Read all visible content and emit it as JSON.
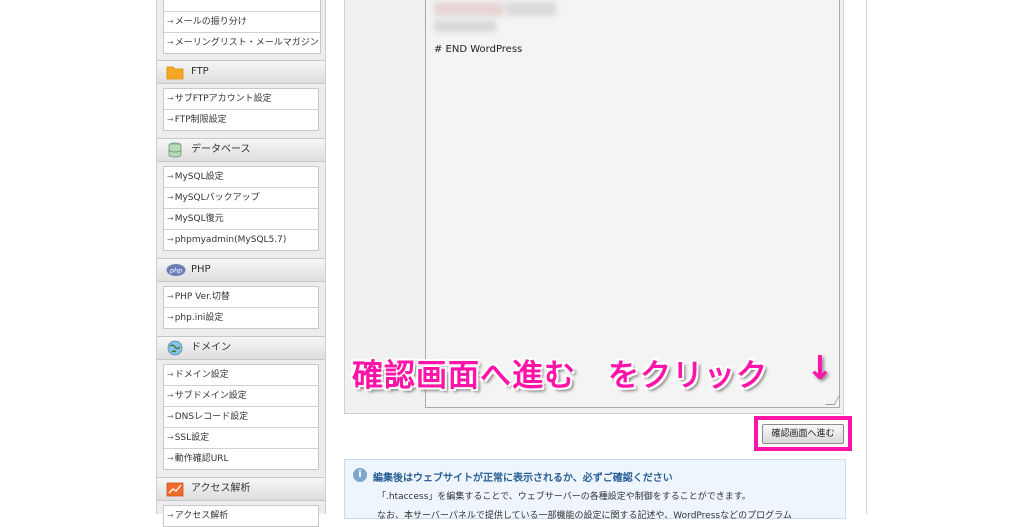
{
  "sidebar": {
    "top_items": [
      "メールの振り分け",
      "メーリングリスト・メールマガジン"
    ],
    "sections": [
      {
        "title": "FTP",
        "icon": "folder-icon",
        "items": [
          "サブFTPアカウント設定",
          "FTP制限設定"
        ]
      },
      {
        "title": "データベース",
        "icon": "database-icon",
        "items": [
          "MySQL設定",
          "MySQLバックアップ",
          "MySQL復元",
          "phpmyadmin(MySQL5.7)"
        ]
      },
      {
        "title": "PHP",
        "icon": "php-icon",
        "items": [
          "PHP Ver.切替",
          "php.ini設定"
        ]
      },
      {
        "title": "ドメイン",
        "icon": "globe-icon",
        "items": [
          "ドメイン設定",
          "サブドメイン設定",
          "DNSレコード設定",
          "SSL設定",
          "動作確認URL"
        ]
      },
      {
        "title": "アクセス解析",
        "icon": "chart-icon",
        "items": [
          "アクセス解析"
        ]
      }
    ]
  },
  "editor": {
    "visible_line": "# END WordPress"
  },
  "annotation": {
    "text": "確認画面へ進む　をクリック",
    "arrow": "↓"
  },
  "confirm_button": {
    "label": "確認画面へ進む"
  },
  "info": {
    "title": "編集後はウェブサイトが正常に表示されるか、必ずご確認ください",
    "text1": "「.htaccess」を編集することで、ウェブサーバーの各種設定や制御をすることができます。",
    "text2": "なお、本サーバーパネルで提供している一部機能の設定に関する記述や、WordPressなどのプログラム"
  },
  "colors": {
    "accent": "#ff14a8",
    "info_title": "#2a5f96"
  }
}
